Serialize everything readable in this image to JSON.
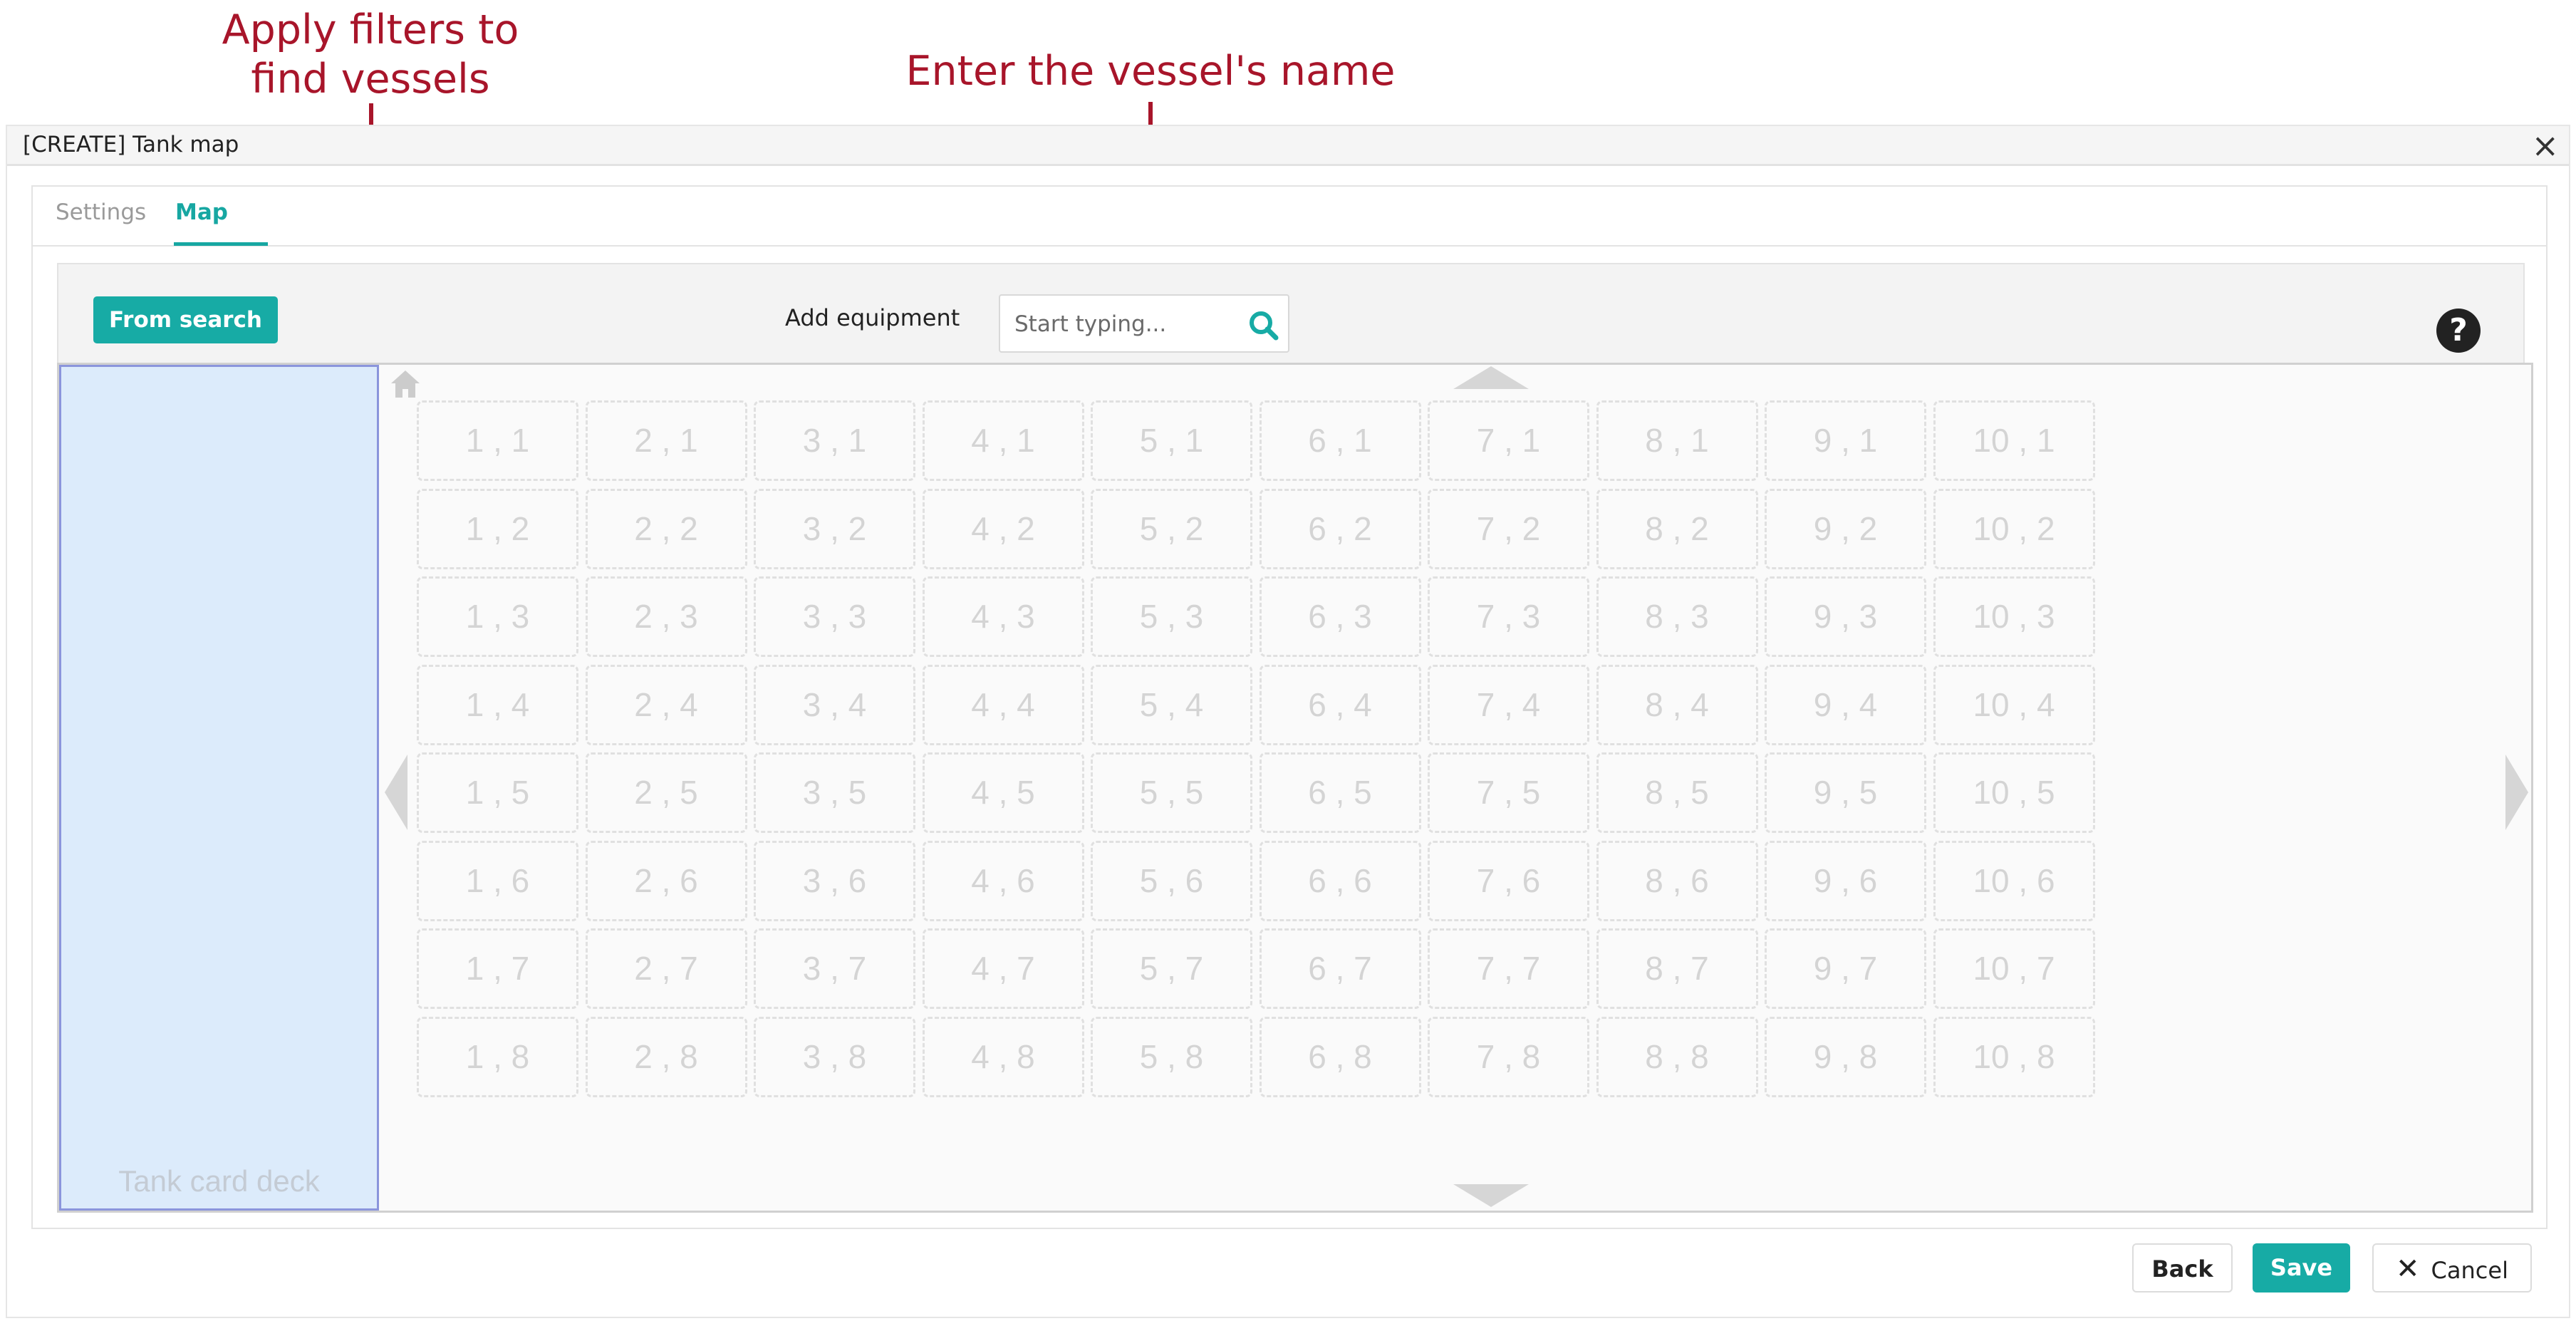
{
  "annotations": {
    "filters_line1": "Apply filters to",
    "filters_line2": "find vessels",
    "vessel_name": "Enter the vessel's name"
  },
  "window": {
    "title": "[CREATE] Tank map",
    "close": "×"
  },
  "tabs": [
    {
      "label": "Settings",
      "active": false
    },
    {
      "label": "Map",
      "active": true
    }
  ],
  "toolbar": {
    "from_search": "From search",
    "add_equipment_label": "Add equipment",
    "search_placeholder": "Start typing...",
    "help": "?"
  },
  "map": {
    "deck_label": "Tank card deck",
    "columns": 10,
    "rows": 8
  },
  "footer": {
    "back": "Back",
    "save": "Save",
    "cancel": "Cancel"
  },
  "colors": {
    "accent": "#17aba5",
    "annotation": "#a8152a",
    "deck_bg": "#dcebfb",
    "deck_border": "#8b95dc"
  }
}
